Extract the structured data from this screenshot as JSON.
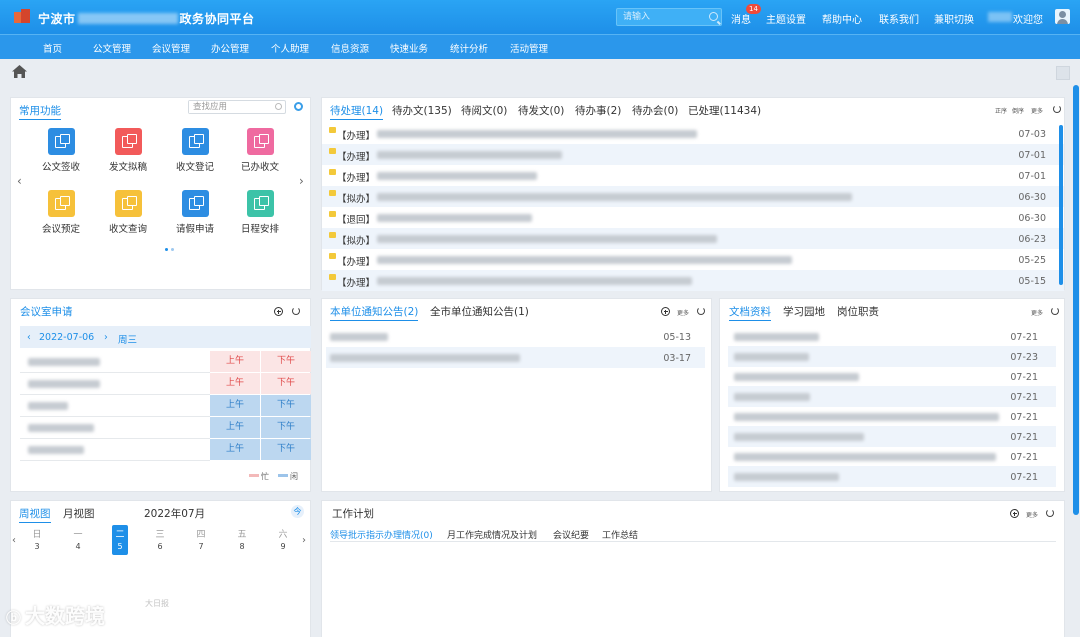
{
  "header": {
    "title_prefix": "宁波市",
    "title_suffix": "政务协同平台",
    "search_placeholder": "请输入",
    "nav": [
      {
        "label": "消息",
        "badge": "14"
      },
      {
        "label": "主题设置"
      },
      {
        "label": "帮助中心"
      },
      {
        "label": "联系我们"
      },
      {
        "label": "兼职切换"
      },
      {
        "label": "欢迎您"
      }
    ]
  },
  "main_nav": [
    "首页",
    "公文管理",
    "会议管理",
    "办公管理",
    "个人助理",
    "信息资源",
    "快速业务",
    "统计分析",
    "活动管理"
  ],
  "common_apps": {
    "title": "常用功能",
    "search_placeholder": "查找应用",
    "items": [
      {
        "label": "公文签收",
        "color": "#2d8de2"
      },
      {
        "label": "发文拟稿",
        "color": "#f25a5a"
      },
      {
        "label": "收文登记",
        "color": "#2d8de2"
      },
      {
        "label": "已办收文",
        "color": "#ef6aa0"
      },
      {
        "label": "会议预定",
        "color": "#f6c13a"
      },
      {
        "label": "收文查询",
        "color": "#f6c13a"
      },
      {
        "label": "请假申请",
        "color": "#2d8de2"
      },
      {
        "label": "日程安排",
        "color": "#3cc3a8"
      }
    ]
  },
  "todo": {
    "tabs": [
      "待处理(14)",
      "待办文(135)",
      "待阅文(0)",
      "待发文(0)",
      "待办事(2)",
      "待办会(0)",
      "已处理(11434)"
    ],
    "tools": [
      "正序",
      "倒序",
      "更多"
    ],
    "rows": [
      {
        "tag": "【办理】",
        "date": "07-03"
      },
      {
        "tag": "【办理】",
        "date": "07-01"
      },
      {
        "tag": "【办理】",
        "date": "07-01"
      },
      {
        "tag": "【拟办】",
        "date": "06-30"
      },
      {
        "tag": "【退回】",
        "date": "06-30"
      },
      {
        "tag": "【拟办】",
        "date": "06-23"
      },
      {
        "tag": "【办理】",
        "date": "05-25"
      },
      {
        "tag": "【办理】",
        "date": "05-15"
      }
    ]
  },
  "meeting": {
    "title": "会议室申请",
    "date": "2022-07-06",
    "weekday": "周三",
    "prev": "‹",
    "next": "›",
    "am": "上午",
    "pm": "下午",
    "legend_busy": "忙",
    "legend_free": "闲",
    "rows": [
      {
        "status": "busy"
      },
      {
        "status": "busy"
      },
      {
        "status": "free"
      },
      {
        "status": "free"
      },
      {
        "status": "free"
      }
    ]
  },
  "notice": {
    "tabs": [
      "本单位通知公告(2)",
      "全市单位通知公告(1)"
    ],
    "more": "更多",
    "rows": [
      {
        "date": "05-13"
      },
      {
        "date": "03-17"
      }
    ]
  },
  "docs": {
    "tabs": [
      "文档资料",
      "学习园地",
      "岗位职责"
    ],
    "more": "更多",
    "rows": [
      {
        "date": "07-21"
      },
      {
        "date": "07-23"
      },
      {
        "date": "07-21"
      },
      {
        "date": "07-21"
      },
      {
        "date": "07-21"
      },
      {
        "date": "07-21"
      },
      {
        "date": "07-21"
      },
      {
        "date": "07-21"
      }
    ]
  },
  "calendar": {
    "tabs": [
      "周视图",
      "月视图"
    ],
    "month": "2022年07月",
    "today": "今",
    "days": [
      {
        "d": "日",
        "n": "3"
      },
      {
        "d": "一",
        "n": "4"
      },
      {
        "d": "二",
        "n": "5"
      },
      {
        "d": "三",
        "n": "6"
      },
      {
        "d": "四",
        "n": "7"
      },
      {
        "d": "五",
        "n": "8"
      },
      {
        "d": "六",
        "n": "9"
      }
    ],
    "prev": "‹",
    "next": "›"
  },
  "workplan": {
    "title": "工作计划",
    "more": "更多",
    "subtabs": [
      "领导批示指示办理情况(0)",
      "月工作完成情况及计划",
      "会议纪要",
      "工作总结"
    ]
  },
  "watermark": {
    "text": "大数跨境",
    "sub": "大日报"
  }
}
